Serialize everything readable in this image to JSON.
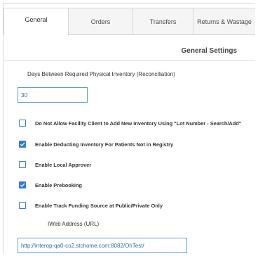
{
  "tabs": [
    {
      "label": "General",
      "active": true
    },
    {
      "label": "Orders",
      "active": false
    },
    {
      "label": "Transfers",
      "active": false
    },
    {
      "label": "Returns & Wastage",
      "active": false
    }
  ],
  "section": {
    "title": "General Settings"
  },
  "days_field": {
    "label": "Days Between Required Physical Inventory (Reconciliation)",
    "value": "30"
  },
  "options": [
    {
      "label": "Do Not Allow Facility Client to Add New Inventory Using \"Lot Number - Search/Add\"",
      "checked": false
    },
    {
      "label": "Enable Deducting Inventory For Patients Not in Registry",
      "checked": true
    },
    {
      "label": "Enable Local Approver",
      "checked": false
    },
    {
      "label": "Enable Prebooking",
      "checked": true
    },
    {
      "label": "Enable Track Funding Source at Public/Private Only",
      "checked": false
    }
  ],
  "iweb": {
    "label": "IWeb Address (URL)",
    "value": "http://interop-qa0-co2.stchome.com:8082/OhTest/"
  },
  "colors": {
    "accent": "#2f7bdc",
    "input_border": "#5b9bd5"
  }
}
